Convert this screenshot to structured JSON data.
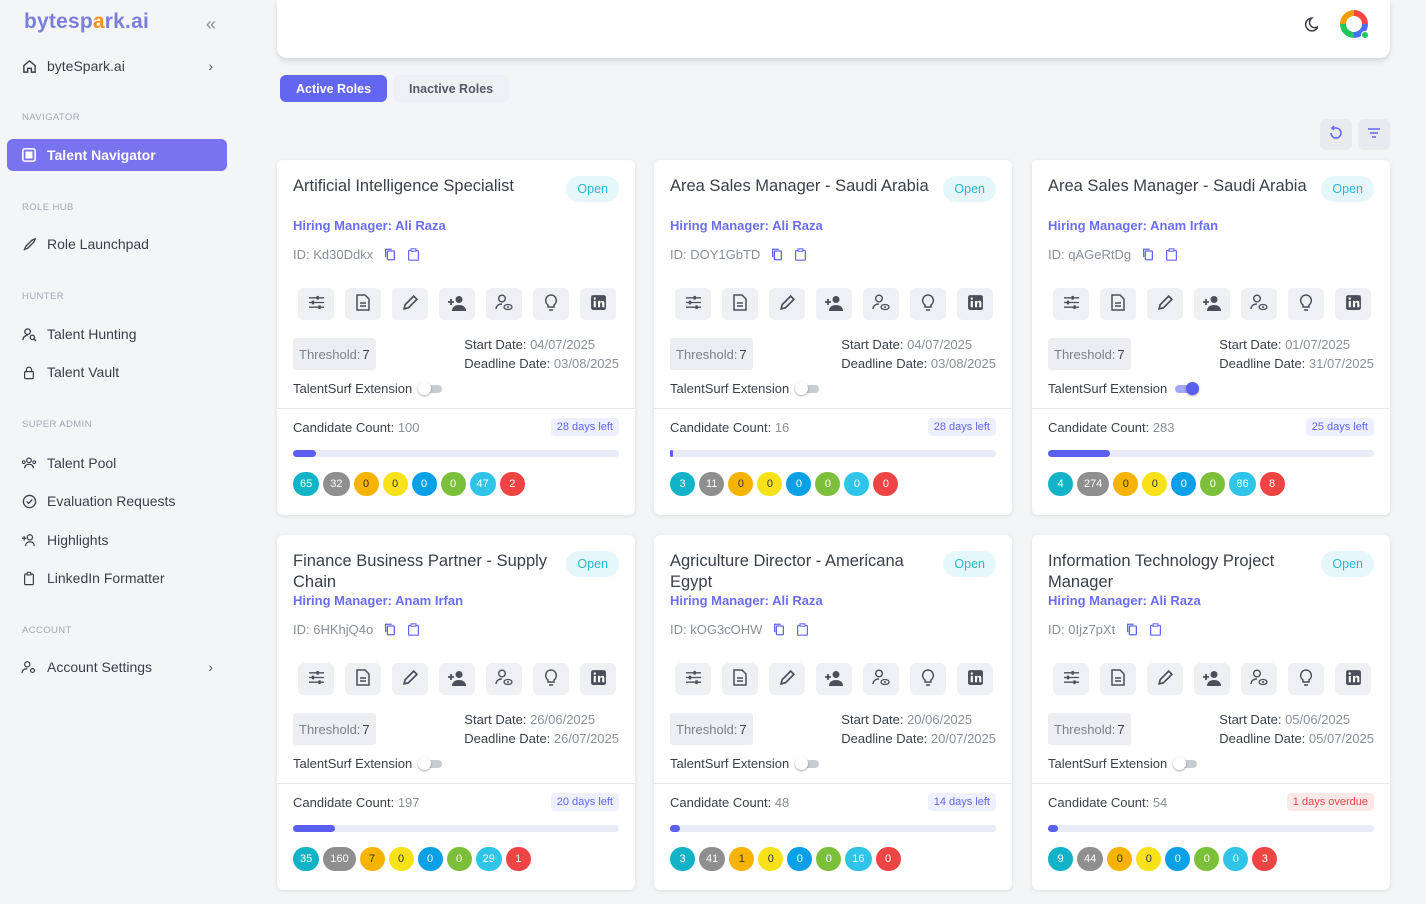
{
  "sidebar": {
    "logo_a": "bytesp",
    "logo_o": "a",
    "logo_b": "rk.ai",
    "org": "byteSpark.ai",
    "sections": {
      "navigator": "NAVIGATOR",
      "rolehub": "ROLE HUB",
      "hunter": "HUNTER",
      "superadmin": "SUPER ADMIN",
      "account": "ACCOUNT"
    },
    "items": {
      "talent_navigator": "Talent Navigator",
      "role_launchpad": "Role Launchpad",
      "talent_hunting": "Talent Hunting",
      "talent_vault": "Talent Vault",
      "talent_pool": "Talent Pool",
      "evaluation_requests": "Evaluation Requests",
      "highlights": "Highlights",
      "linkedin_formatter": "LinkedIn Formatter",
      "account_settings": "Account Settings"
    }
  },
  "tabs": {
    "active": "Active Roles",
    "inactive": "Inactive Roles"
  },
  "labels": {
    "open": "Open",
    "hiring_manager": "Hiring Manager:",
    "threshold": "Threshold:",
    "start_date": "Start Date:",
    "deadline_date": "Deadline Date:",
    "extension": "TalentSurf Extension",
    "candidate_count": "Candidate Count:"
  },
  "colors": {
    "accent": "#6366f1",
    "open_badge": "#2bb6d4",
    "overdue": "#e5484d"
  },
  "cards": [
    {
      "title": "Artificial Intelligence Specialist",
      "manager": "Ali Raza",
      "id": "ID: Kd30Ddkx",
      "threshold": "7",
      "start": "04/07/2025",
      "deadline": "03/08/2025",
      "extension_on": false,
      "count": "100",
      "days": "28 days left",
      "overdue": false,
      "progress": 0.07,
      "chips": [
        "65",
        "32",
        "0",
        "0",
        "0",
        "0",
        "47",
        "2"
      ]
    },
    {
      "title": "Area Sales Manager - Saudi Arabia",
      "manager": "Ali Raza",
      "id": "ID: DOY1GbTD",
      "threshold": "7",
      "start": "04/07/2025",
      "deadline": "03/08/2025",
      "extension_on": false,
      "count": "16",
      "days": "28 days left",
      "overdue": false,
      "progress": 0.01,
      "chips": [
        "3",
        "11",
        "0",
        "0",
        "0",
        "0",
        "0",
        "0"
      ]
    },
    {
      "title": "Area Sales Manager - Saudi Arabia",
      "manager": "Anam Irfan",
      "id": "ID: qAGeRtDg",
      "threshold": "7",
      "start": "01/07/2025",
      "deadline": "31/07/2025",
      "extension_on": true,
      "count": "283",
      "days": "25 days left",
      "overdue": false,
      "progress": 0.19,
      "chips": [
        "4",
        "274",
        "0",
        "0",
        "0",
        "0",
        "86",
        "8"
      ]
    },
    {
      "title": "Finance Business Partner - Supply Chain",
      "manager": "Anam Irfan",
      "id": "ID: 6HKhjQ4o",
      "threshold": "7",
      "start": "26/06/2025",
      "deadline": "26/07/2025",
      "extension_on": false,
      "count": "197",
      "days": "20 days left",
      "overdue": false,
      "progress": 0.13,
      "chips": [
        "35",
        "160",
        "7",
        "0",
        "0",
        "0",
        "29",
        "1"
      ]
    },
    {
      "title": "Agriculture Director - Americana Egypt",
      "manager": "Ali Raza",
      "id": "ID: kOG3cOHW",
      "threshold": "7",
      "start": "20/06/2025",
      "deadline": "20/07/2025",
      "extension_on": false,
      "count": "48",
      "days": "14 days left",
      "overdue": false,
      "progress": 0.03,
      "chips": [
        "3",
        "41",
        "1",
        "0",
        "0",
        "0",
        "16",
        "0"
      ]
    },
    {
      "title": "Information Technology Project Manager",
      "manager": "Ali Raza",
      "id": "ID: 0Ijz7pXt",
      "threshold": "7",
      "start": "05/06/2025",
      "deadline": "05/07/2025",
      "extension_on": false,
      "count": "54",
      "days": "1 days overdue",
      "overdue": true,
      "progress": 0.03,
      "chips": [
        "9",
        "44",
        "0",
        "0",
        "0",
        "0",
        "0",
        "3"
      ]
    }
  ]
}
